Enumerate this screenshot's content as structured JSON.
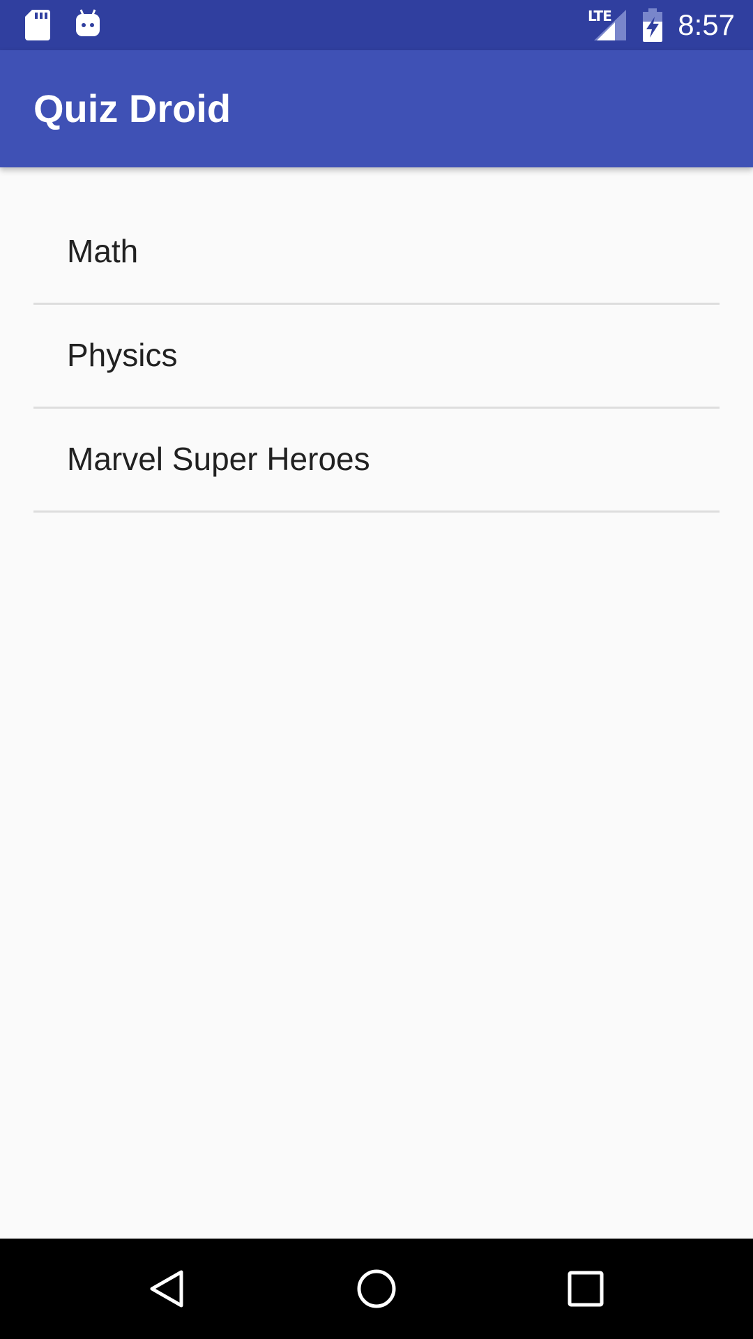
{
  "status_bar": {
    "network": "LTE",
    "time": "8:57",
    "icons": [
      "sd-card-icon",
      "android-icon",
      "signal-icon",
      "battery-charging-icon"
    ],
    "color": "#303f9f"
  },
  "app_bar": {
    "title": "Quiz Droid",
    "color": "#3f51b5"
  },
  "topics": [
    {
      "label": "Math"
    },
    {
      "label": "Physics"
    },
    {
      "label": "Marvel Super Heroes"
    }
  ],
  "nav_bar": {
    "buttons": [
      "back-icon",
      "home-icon",
      "recents-icon"
    ]
  }
}
